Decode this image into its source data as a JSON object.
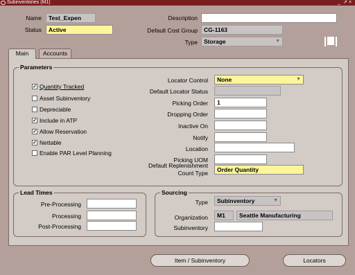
{
  "window": {
    "title": "Subinventories (M1)",
    "controls": [
      "_",
      "↗",
      "×"
    ]
  },
  "header": {
    "name_label": "Name",
    "name_value": "Test_Expen",
    "status_label": "Status",
    "status_value": "Active",
    "description_label": "Description",
    "description_value": "",
    "default_cost_group_label": "Default Cost Group",
    "default_cost_group_value": "CG-1163",
    "type_label": "Type",
    "type_value": "Storage"
  },
  "tabs": [
    {
      "label": "Main",
      "active": true
    },
    {
      "label": "Accounts",
      "active": false
    }
  ],
  "parameters": {
    "title": "Parameters",
    "checkboxes": [
      {
        "label": "Quantity Tracked",
        "checked": true
      },
      {
        "label": "Asset Subinventory",
        "checked": false
      },
      {
        "label": "Depreciable",
        "checked": false
      },
      {
        "label": "Include in ATP",
        "checked": true
      },
      {
        "label": "Allow Reservation",
        "checked": true
      },
      {
        "label": "Nettable",
        "checked": true
      },
      {
        "label": "Enable PAR Level Planning",
        "checked": false
      }
    ],
    "locator_control_label": "Locator Control",
    "locator_control_value": "None",
    "default_locator_status_label": "Default Locator Status",
    "default_locator_status_value": "",
    "picking_order_label": "Picking Order",
    "picking_order_value": "1",
    "dropping_order_label": "Dropping Order",
    "dropping_order_value": "",
    "inactive_on_label": "Inactive On",
    "inactive_on_value": "",
    "notify_label": "Notify",
    "notify_value": "",
    "location_label": "Location",
    "location_value": "",
    "picking_uom_label": "Picking UOM",
    "picking_uom_value": "",
    "default_replenishment_label_1": "Default Replenishment",
    "default_replenishment_label_2": "Count Type",
    "default_replenishment_value": "Order Quantity"
  },
  "lead_times": {
    "title": "Lead Times",
    "pre_processing_label": "Pre-Processing",
    "pre_processing_value": "",
    "processing_label": "Processing",
    "processing_value": "",
    "post_processing_label": "Post-Processing",
    "post_processing_value": ""
  },
  "sourcing": {
    "title": "Sourcing",
    "type_label": "Type",
    "type_value": "Subinventory",
    "organization_label": "Organization",
    "organization_code": "M1",
    "organization_name": "Seattle Manufacturing",
    "subinventory_label": "Subinventory",
    "subinventory_value": ""
  },
  "buttons": {
    "item_subinventory": "Item / Subinventory",
    "locators": "Locators"
  },
  "colors": {
    "background": "#b4a09a",
    "required_field": "#fdf59a",
    "title_bar": "#7a1f1f"
  }
}
